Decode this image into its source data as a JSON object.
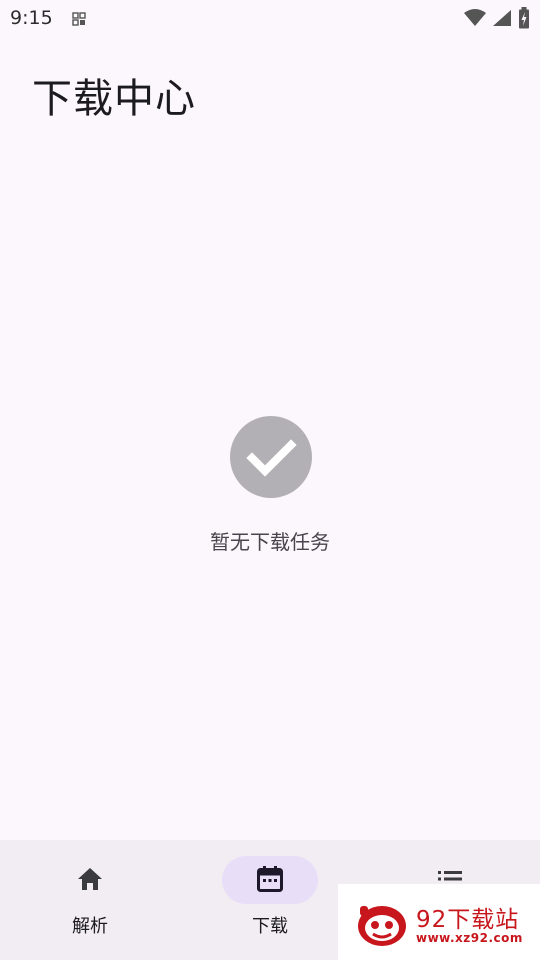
{
  "status_bar": {
    "time": "9:15",
    "icons": [
      "notification-icon",
      "wifi-icon",
      "signal-icon",
      "battery-charging-icon"
    ]
  },
  "header": {
    "title": "下载中心"
  },
  "empty_state": {
    "icon": "check-circle-icon",
    "message": "暂无下载任务"
  },
  "bottom_nav": {
    "items": [
      {
        "label": "解析",
        "icon": "home-icon",
        "active": false
      },
      {
        "label": "下载",
        "icon": "calendar-icon",
        "active": true
      },
      {
        "label": "",
        "icon": "list-icon",
        "active": false
      }
    ]
  },
  "watermark": {
    "name": "92下载站",
    "url": "www.xz92.com"
  },
  "colors": {
    "background": "#fcf7fc",
    "nav_background": "#f2edf3",
    "active_pill": "#e8def8",
    "empty_icon": "#b3b0b5",
    "watermark_red": "#c8161d"
  }
}
